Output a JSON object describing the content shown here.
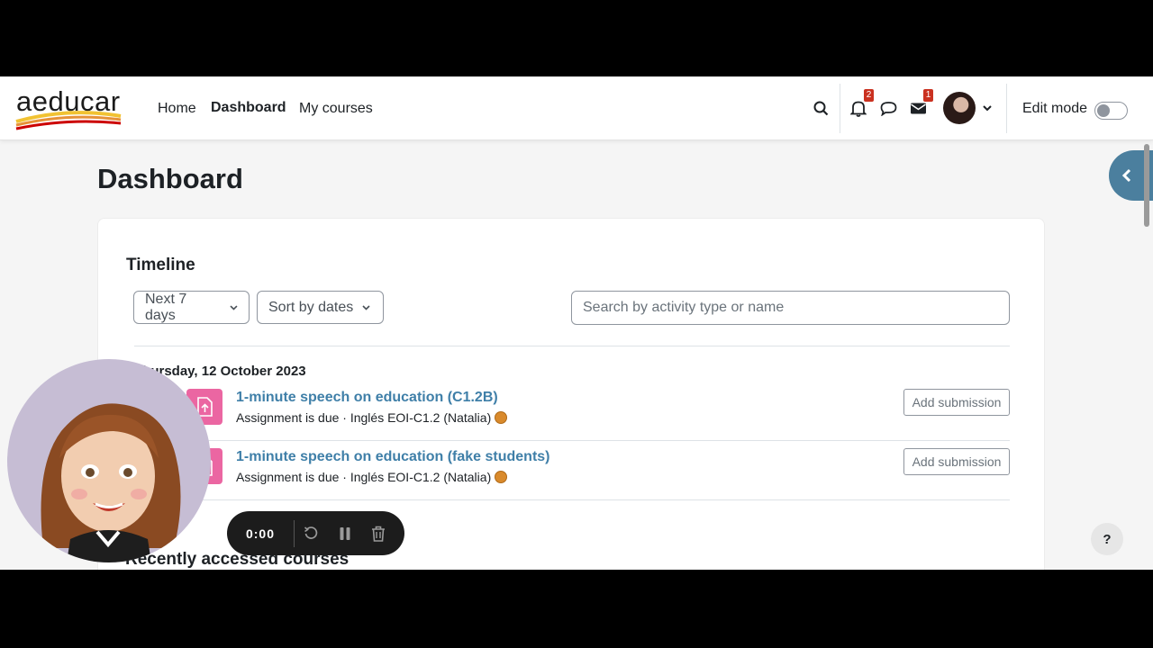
{
  "nav": {
    "logo_text": "aeducar",
    "links": [
      "Home",
      "Dashboard",
      "My courses"
    ],
    "notifications_count": "2",
    "messages_count": "1",
    "edit_mode_label": "Edit mode",
    "edit_mode_on": false
  },
  "page": {
    "title": "Dashboard"
  },
  "timeline": {
    "title": "Timeline",
    "filter_label": "Next 7 days",
    "sort_label": "Sort by dates",
    "search_placeholder": "Search by activity type or name",
    "date_heading": "Thursday, 12 October 2023",
    "events": [
      {
        "title": "1-minute speech on education (C1.2B)",
        "subtitle": "Assignment is due · Inglés EOI-C1.2 (Natalia)",
        "action": "Add submission"
      },
      {
        "title": "1-minute speech on education (fake students)",
        "subtitle": "Assignment is due · Inglés EOI-C1.2 (Natalia)",
        "action": "Add submission"
      }
    ]
  },
  "recent": {
    "title": "Recently accessed courses"
  },
  "help": {
    "label": "?"
  },
  "recorder": {
    "time": "0:00"
  },
  "colors": {
    "accent": "#3f7fa8",
    "assignment_icon": "#eb66a2",
    "drawer": "#4b7f9e"
  }
}
